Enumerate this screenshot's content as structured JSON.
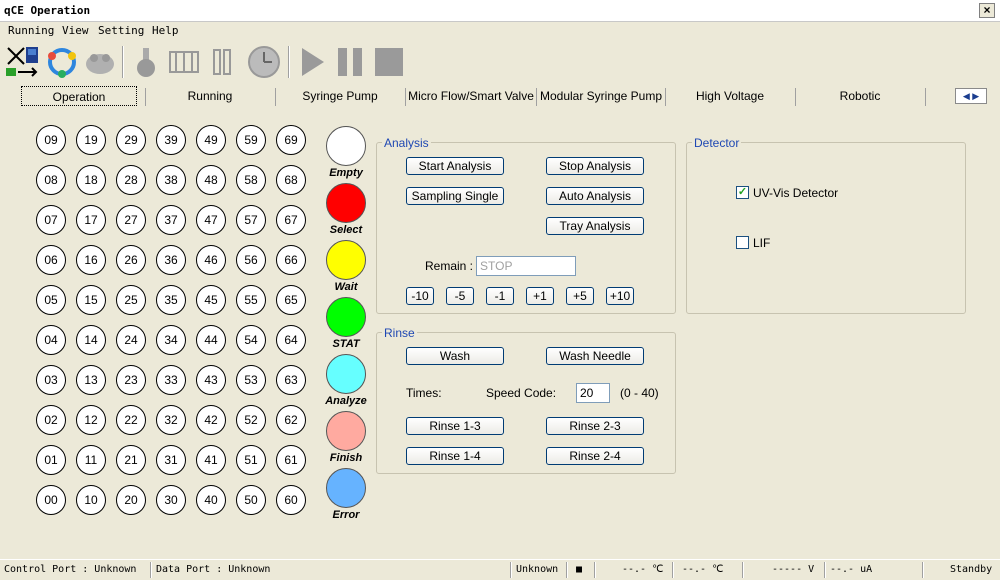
{
  "window": {
    "title": "qCE Operation",
    "close": "×"
  },
  "menu": [
    "Running",
    "View",
    "Setting",
    "Help"
  ],
  "toolbar": [
    "connect-icon",
    "refresh-icon",
    "robot-icon",
    "flask-icon",
    "valve-icon",
    "syringe-icon",
    "clock-icon",
    "play-icon",
    "pause-icon",
    "stop-icon"
  ],
  "tabs": [
    "Operation",
    "Running",
    "Syringe Pump",
    "Micro Flow/Smart Valve",
    "Modular Syringe Pump",
    "High Voltage",
    "Robotic"
  ],
  "tab_scroll": {
    "left": "◀",
    "right": "▶"
  },
  "tray": {
    "columns": [
      [
        "09",
        "08",
        "07",
        "06",
        "05",
        "04",
        "03",
        "02",
        "01",
        "00"
      ],
      [
        "19",
        "18",
        "17",
        "16",
        "15",
        "14",
        "13",
        "12",
        "11",
        "10"
      ],
      [
        "29",
        "28",
        "27",
        "26",
        "25",
        "24",
        "23",
        "22",
        "21",
        "20"
      ],
      [
        "39",
        "38",
        "37",
        "36",
        "35",
        "34",
        "33",
        "32",
        "31",
        "30"
      ],
      [
        "49",
        "48",
        "47",
        "46",
        "45",
        "44",
        "43",
        "42",
        "41",
        "40"
      ],
      [
        "59",
        "58",
        "57",
        "56",
        "55",
        "54",
        "53",
        "52",
        "51",
        "50"
      ],
      [
        "69",
        "68",
        "67",
        "66",
        "65",
        "64",
        "63",
        "62",
        "61",
        "60"
      ]
    ]
  },
  "legend": [
    {
      "label": "Empty",
      "color": "#FFFFFF"
    },
    {
      "label": "Select",
      "color": "#FF0000"
    },
    {
      "label": "Wait",
      "color": "#FFFF00"
    },
    {
      "label": "STAT",
      "color": "#00FF00"
    },
    {
      "label": "Analyze",
      "color": "#66FFFF"
    },
    {
      "label": "Finish",
      "color": "#FFAAA0"
    },
    {
      "label": "Error",
      "color": "#66B3FF"
    }
  ],
  "analysis": {
    "title": "Analysis",
    "start": "Start Analysis",
    "stop": "Stop Analysis",
    "sampling_single": "Sampling Single",
    "auto": "Auto Analysis",
    "tray": "Tray Analysis",
    "remain_label": "Remain :",
    "remain_value": "STOP",
    "steps": [
      "-10",
      "-5",
      "-1",
      "+1",
      "+5",
      "+10"
    ]
  },
  "rinse": {
    "title": "Rinse",
    "wash": "Wash",
    "wash_needle": "Wash Needle",
    "times_label": "Times:",
    "speed_label": "Speed Code:",
    "speed_value": "20",
    "speed_range": "(0 - 40)",
    "rinse13": "Rinse 1-3",
    "rinse23": "Rinse 2-3",
    "rinse14": "Rinse 1-4",
    "rinse24": "Rinse 2-4"
  },
  "detector": {
    "title": "Detector",
    "uvvis": "UV-Vis Detector",
    "uvvis_checked": true,
    "lif": "LIF",
    "lif_checked": false
  },
  "status": {
    "control_port": "Control Port : Unknown",
    "data_port": "Data Port : Unknown",
    "unknown": "Unknown",
    "indicator": "■",
    "temp1": "--.- ℃",
    "temp2": "--.- ℃",
    "voltage": "----- V",
    "current": "--.- uA",
    "state": "Standby"
  }
}
